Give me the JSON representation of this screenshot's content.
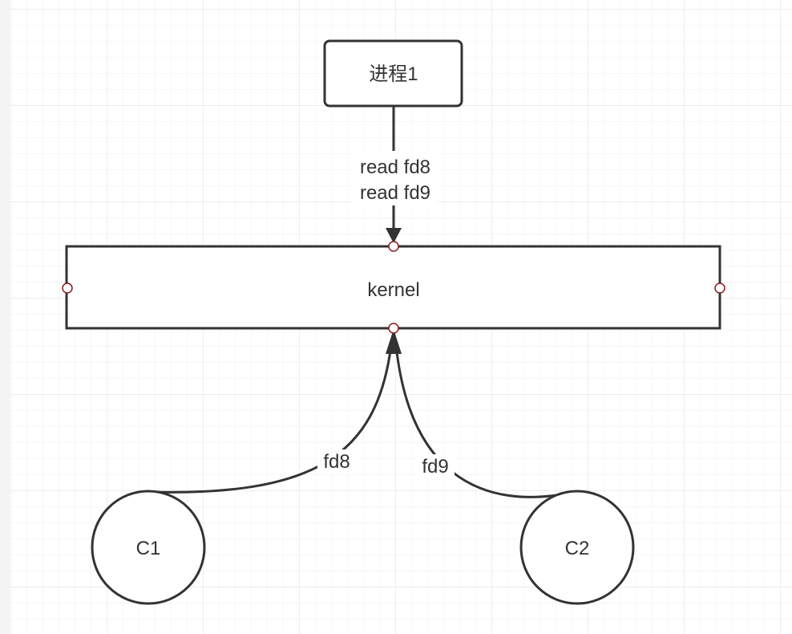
{
  "nodes": {
    "process": {
      "label": "进程1"
    },
    "kernel": {
      "label": "kernel"
    },
    "c1": {
      "label": "C1"
    },
    "c2": {
      "label": "C2"
    }
  },
  "edges": {
    "read": {
      "label_line1": "read fd8",
      "label_line2": "read fd9"
    },
    "fd8": {
      "label": "fd8"
    },
    "fd9": {
      "label": "fd9"
    }
  },
  "colors": {
    "stroke": "#333333",
    "grid": "#e6e6e6",
    "connection_point": "#8b1a1a"
  }
}
